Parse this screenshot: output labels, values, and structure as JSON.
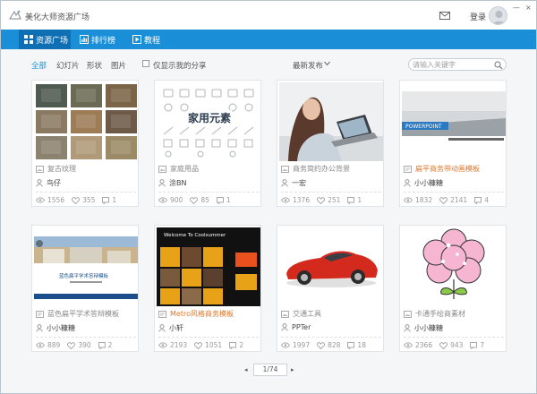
{
  "app": {
    "title": "美化大师资源广场",
    "login": "登录",
    "window_controls": [
      "—",
      "×"
    ]
  },
  "nav": {
    "tabs": [
      {
        "label": "资源广场",
        "icon": "grid-icon",
        "active": true
      },
      {
        "label": "排行榜",
        "icon": "bar-chart-icon",
        "active": false
      },
      {
        "label": "教程",
        "icon": "play-icon",
        "active": false
      }
    ]
  },
  "filters": {
    "categories": [
      "全部",
      "幻灯片",
      "形状",
      "图片"
    ],
    "active_index": 0,
    "only_mine": "仅显示我的分享",
    "sort": "最新发布",
    "search_placeholder": "请输入关键字"
  },
  "cards": [
    {
      "title": "复古纹理",
      "author": "鸟仔",
      "views": "1556",
      "likes": "355",
      "comments": "1",
      "type": "image",
      "highlight": false
    },
    {
      "title": "家庭用品",
      "author": "涂BN",
      "views": "900",
      "likes": "85",
      "comments": "1",
      "type": "image",
      "highlight": false,
      "overlay": "家用元素"
    },
    {
      "title": "商务简约办公背景",
      "author": "一宏",
      "views": "1376",
      "likes": "251",
      "comments": "1",
      "type": "image",
      "highlight": false
    },
    {
      "title": "扁平商务带动画模板",
      "author": "小小糠糖",
      "views": "1832",
      "likes": "2141",
      "comments": "4",
      "type": "slide",
      "highlight": true,
      "overlay": "POWERPOINT"
    },
    {
      "title": "蓝色扁平学术答辩模板",
      "author": "小小糠糖",
      "views": "889",
      "likes": "390",
      "comments": "2",
      "type": "slide",
      "highlight": false,
      "overlay": "蓝色扁平学术答辩模板"
    },
    {
      "title": "Metro风格商务模板",
      "author": "小轩",
      "views": "2193",
      "likes": "1051",
      "comments": "2",
      "type": "slide",
      "highlight": true,
      "overlay": "Welcome To Coolsummer"
    },
    {
      "title": "交通工具",
      "author": "PPTer",
      "views": "1997",
      "likes": "828",
      "comments": "18",
      "type": "image",
      "highlight": false
    },
    {
      "title": "卡通手绘商素材",
      "author": "小小糠糖",
      "views": "2366",
      "likes": "943",
      "comments": "7",
      "type": "image",
      "highlight": false
    }
  ],
  "pagination": {
    "prev": "◂",
    "current": "1/74",
    "next": "▸"
  },
  "colors": {
    "accent": "#1a8fd8",
    "nav_active": "#0f6fb4",
    "highlight": "#e0782a"
  }
}
